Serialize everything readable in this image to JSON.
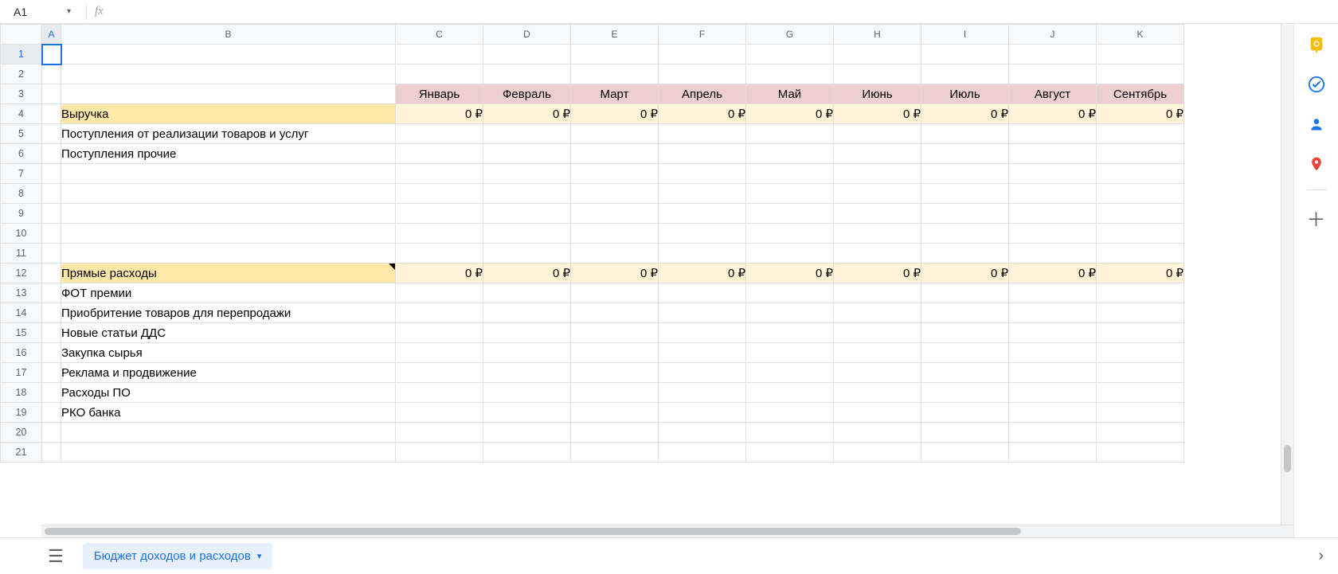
{
  "nameBox": {
    "value": "A1"
  },
  "formulaBar": {
    "fxLabel": "fx",
    "value": ""
  },
  "columns": [
    "A",
    "B",
    "C",
    "D",
    "E",
    "F",
    "G",
    "H",
    "I",
    "J",
    "K"
  ],
  "activeColumn": "A",
  "activeRow": 1,
  "rowCount": 21,
  "months": {
    "C": "Январь",
    "D": "Февраль",
    "E": "Март",
    "F": "Апрель",
    "G": "Май",
    "H": "Июнь",
    "I": "Июль",
    "J": "Август",
    "K": "Сентябрь"
  },
  "zeroRuble": "0 ₽",
  "sections": {
    "revenue": {
      "title": "Выручка",
      "items": [
        "Поступления от реализации товаров и услуг",
        "Поступления прочие"
      ]
    },
    "directCosts": {
      "title": "Прямые расходы",
      "items": [
        "ФОТ премии",
        "Приобритение товаров для перепродажи",
        "Новые статьи ДДС",
        "Закупка сырья",
        "Реклама и продвижение",
        "Расходы ПО",
        "РКО банка"
      ]
    }
  },
  "tabs": {
    "active": "Бюджет доходов и расходов"
  },
  "sidePanel": {
    "keep": "keep-icon",
    "tasks": "tasks-icon",
    "contacts": "contacts-icon",
    "maps": "maps-icon",
    "add": "add-icon"
  }
}
